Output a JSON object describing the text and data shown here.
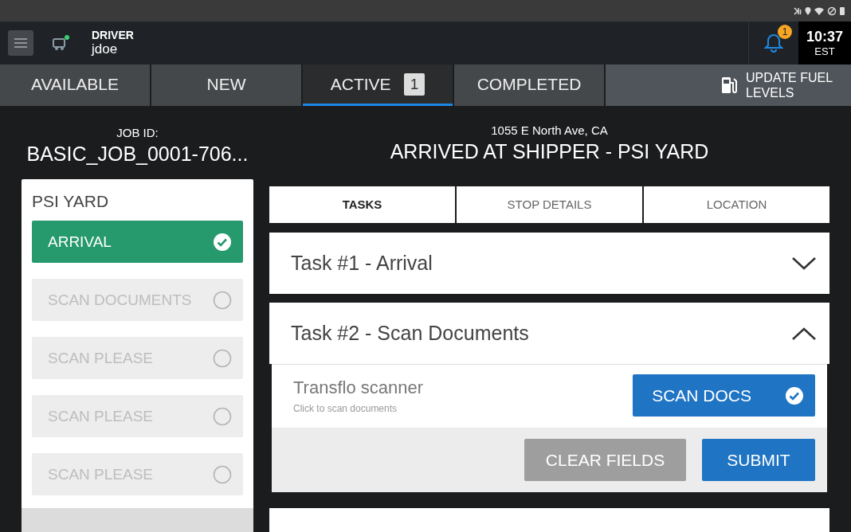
{
  "header": {
    "role": "DRIVER",
    "username": "jdoe",
    "online": true,
    "notification_count": "1",
    "time": "10:37",
    "timezone": "EST"
  },
  "tabs": [
    {
      "label": "AVAILABLE",
      "selected": false
    },
    {
      "label": "NEW",
      "selected": false
    },
    {
      "label": "ACTIVE",
      "selected": true,
      "count": "1"
    },
    {
      "label": "COMPLETED",
      "selected": false
    }
  ],
  "fuel_button": {
    "label": "UPDATE FUEL LEVELS"
  },
  "job": {
    "label": "JOB ID:",
    "id": "BASIC_JOB_0001-706..."
  },
  "stop": {
    "address": "1055 E North Ave, CA",
    "status": "ARRIVED AT SHIPPER - PSI YARD"
  },
  "stop_card": {
    "name": "PSI YARD",
    "steps": [
      {
        "label": "ARRIVAL",
        "completed": true
      },
      {
        "label": "SCAN DOCUMENTS",
        "completed": false
      },
      {
        "label": "SCAN PLEASE",
        "completed": false
      },
      {
        "label": "SCAN PLEASE",
        "completed": false
      },
      {
        "label": "SCAN PLEASE",
        "completed": false
      }
    ]
  },
  "detail_tabs": [
    {
      "label": "TASKS",
      "selected": true
    },
    {
      "label": "STOP DETAILS",
      "selected": false
    },
    {
      "label": "LOCATION",
      "selected": false
    }
  ],
  "tasks": [
    {
      "title": "Task #1 - Arrival",
      "expanded": false
    },
    {
      "title": "Task #2 - Scan Documents",
      "expanded": true,
      "field": {
        "title": "Transflo scanner",
        "hint": "Click to scan documents",
        "button": "SCAN DOCS",
        "done": true
      },
      "actions": [
        {
          "label": "CLEAR FIELDS",
          "kind": "secondary"
        },
        {
          "label": "SUBMIT",
          "kind": "primary"
        }
      ]
    }
  ]
}
